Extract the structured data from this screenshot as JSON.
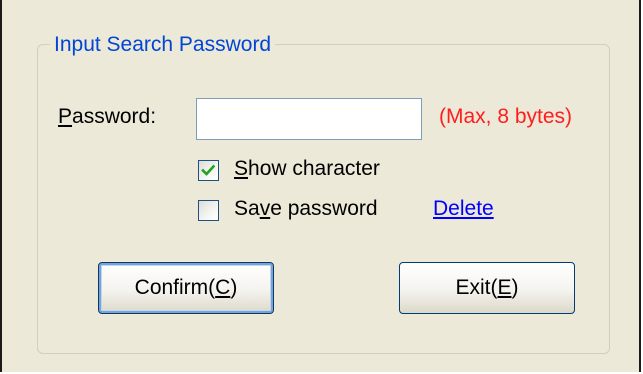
{
  "group": {
    "title": "Input Search Password"
  },
  "password": {
    "label_accel": "P",
    "label_rest": "assword:",
    "value": "",
    "hint": "(Max, 8 bytes)"
  },
  "show_character": {
    "checked": true,
    "label_accel": "S",
    "label_rest": "how character"
  },
  "save_password": {
    "checked": false,
    "label_pre": "Sa",
    "label_accel": "v",
    "label_post": "e password",
    "delete_link": "Delete"
  },
  "buttons": {
    "confirm_pre": "Confirm(",
    "confirm_accel": "C",
    "confirm_post": ")",
    "exit_pre": "Exit(",
    "exit_accel": "E",
    "exit_post": ")"
  },
  "colors": {
    "dialog_bg": "#ECE9D8",
    "group_title": "#0046D5",
    "hint": "#FF1E1E",
    "link": "#0000FF",
    "checkmark": "#21A121"
  },
  "icons": {
    "checkmark": "checkmark-icon"
  }
}
